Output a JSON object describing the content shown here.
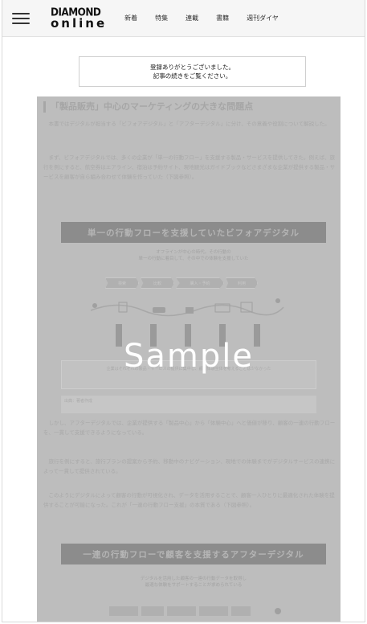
{
  "header": {
    "logo_top": "DIAMOND",
    "logo_bottom": "online",
    "nav": [
      "新着",
      "特集",
      "連載",
      "書籍",
      "週刊ダイヤ"
    ]
  },
  "notice": {
    "line1": "登録ありがとうございました。",
    "line2": "記事の続きをご覧ください。"
  },
  "article": {
    "title": "「製品販売」中心のマーケティングの大きな問題点",
    "para1": "　本書ではデジタルが担当する「ビフォアデジタル」と「アフターデジタル」に分け、その意義や役割について解説した。",
    "para2": "　まず、ビフォアデジタルでは、多くの企業が「単一の行動フロー」を支援する製品・サービスを提供してきた。例えば、旅行を例にすると、航空券はエアライン、宿泊は予約サイト、現地観光はガイドブックなどさまざまな企業が提供する製品・サービスを顧客が自ら組み合わせて体験を作っていた（下図参照）。",
    "banner1": "単一の行動フローを支援していたビフォアデジタル",
    "diagram1_caption": "オフラインが中心の時代。その行動の\n単一の行動に着目して、その中での体験を支援していた",
    "flow_steps": [
      "検索",
      "比較",
      "購入・予約",
      "利用"
    ],
    "box1_text": "企業はそれぞれの製品・サービスの提供に集中し、顧客体験全体を考えることは少なかった",
    "box2_text": "出典：著者作成",
    "para3": "　しかし、アフターデジタルでは、企業が提供する「製品中心」から「体験中心」へと価値が移り、顧客の一連の行動フローを、一貫して支援できるようになっている。",
    "para4": "　旅行を例にすると、旅行プランの提案から予約、移動中のナビゲーション、現地での体験までがデジタルサービスの連携によって一貫して提供されている。",
    "para5": "　このようにデジタルによって顧客の行動が可視化され、データを活用することで、顧客一人ひとりに最適化された体験を提供することが可能になった。これが「一連の行動フロー支援」の本質である（下図参照）。",
    "banner2": "一連の行動フローで顧客を支援するアフターデジタル",
    "diagram2_caption": "デジタルを活用した顧客の一連の行動データを取得し\n最適な体験をサポートすることが求められている"
  },
  "watermark": "Sample"
}
